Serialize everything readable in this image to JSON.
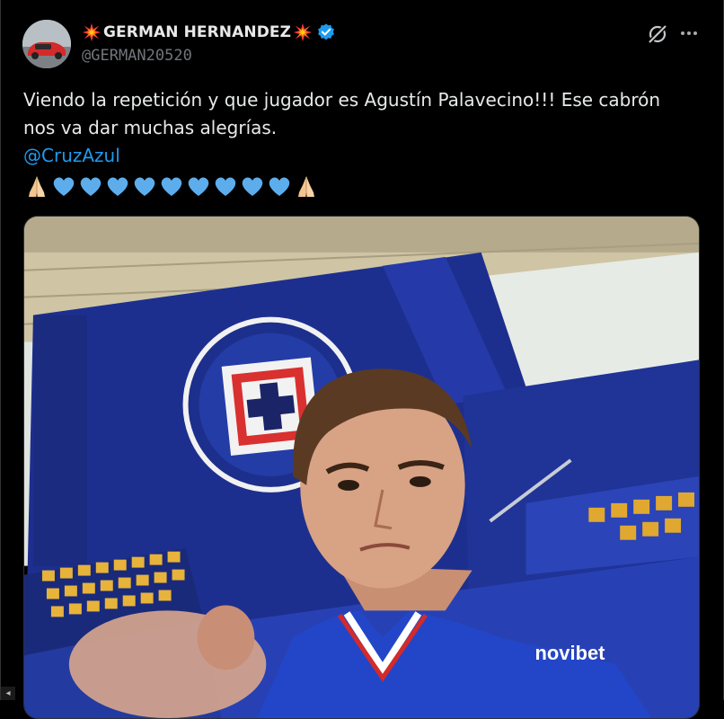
{
  "author": {
    "display_name": "GERMAN HERNANDEZ",
    "handle": "@GERMAN20520",
    "verified": true,
    "name_emoji_left": "collision-icon",
    "name_emoji_right": "collision-icon"
  },
  "tweet": {
    "line1": "Viendo la repetición y que jugador es Agustín Palavecino!!! Ese cabrón",
    "line2": "nos va dar muchas alegrías.",
    "mention": "@CruzAzul",
    "emojis": [
      "folded-hands-icon",
      "blue-heart-icon",
      "blue-heart-icon",
      "blue-heart-icon",
      "blue-heart-icon",
      "blue-heart-icon",
      "blue-heart-icon",
      "blue-heart-icon",
      "blue-heart-icon",
      "blue-heart-icon",
      "folded-hands-icon"
    ]
  },
  "media": {
    "shirt_sponsor": "novibet"
  },
  "colors": {
    "background": "#000000",
    "text": "#e7e9ea",
    "secondary": "#71767b",
    "link": "#1d9bf0",
    "verified": "#1d9bf0"
  }
}
